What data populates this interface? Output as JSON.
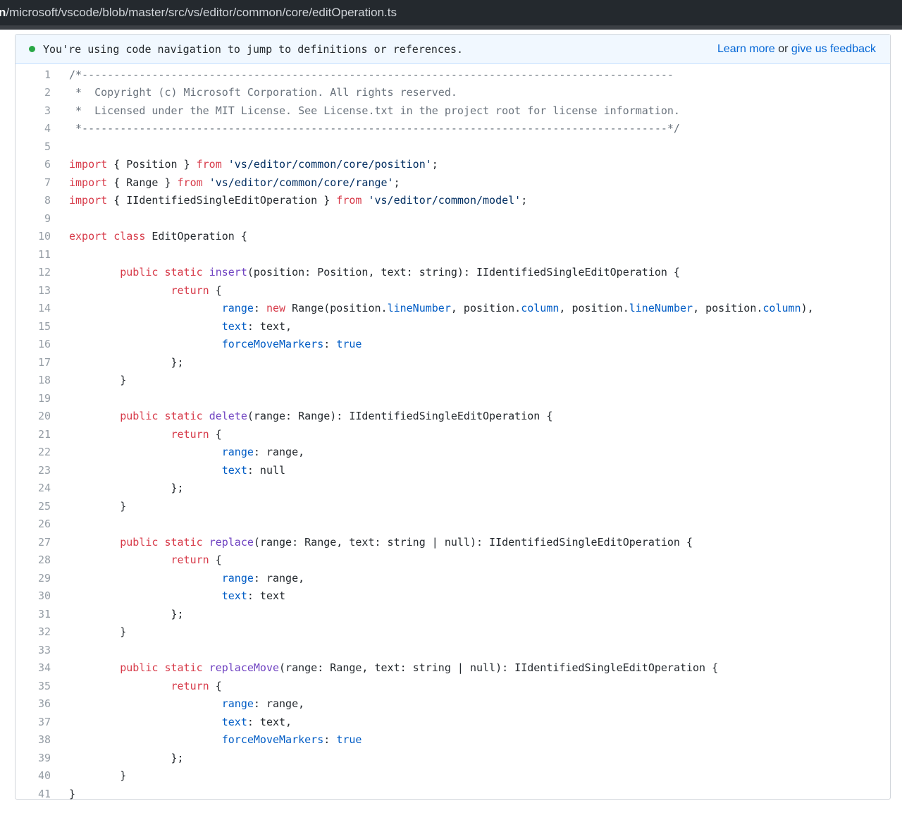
{
  "url_bar": {
    "head": "n",
    "rest": "/microsoft/vscode/blob/master/src/vs/editor/common/core/editOperation.ts"
  },
  "banner": {
    "text": "You're using code navigation to jump to definitions or references.",
    "learn_more": "Learn more",
    "or": "or",
    "feedback": "give us feedback"
  },
  "colors": {
    "keyword": "#d73a49",
    "string": "#032f62",
    "comment": "#6a737d",
    "property": "#005cc5",
    "function": "#6f42c1",
    "link": "#0366d6",
    "status_dot": "#28a745"
  },
  "code_lines": [
    [
      [
        "c",
        "/*---------------------------------------------------------------------------------------------"
      ]
    ],
    [
      [
        "c",
        " *  Copyright (c) Microsoft Corporation. All rights reserved."
      ]
    ],
    [
      [
        "c",
        " *  Licensed under the MIT License. See License.txt in the project root for license information."
      ]
    ],
    [
      [
        "c",
        " *--------------------------------------------------------------------------------------------*/"
      ]
    ],
    [],
    [
      [
        "k",
        "import"
      ],
      [
        "t",
        " { Position } "
      ],
      [
        "k",
        "from"
      ],
      [
        "t",
        " "
      ],
      [
        "s",
        "'vs/editor/common/core/position'"
      ],
      [
        "t",
        ";"
      ]
    ],
    [
      [
        "k",
        "import"
      ],
      [
        "t",
        " { Range } "
      ],
      [
        "k",
        "from"
      ],
      [
        "t",
        " "
      ],
      [
        "s",
        "'vs/editor/common/core/range'"
      ],
      [
        "t",
        ";"
      ]
    ],
    [
      [
        "k",
        "import"
      ],
      [
        "t",
        " { IIdentifiedSingleEditOperation } "
      ],
      [
        "k",
        "from"
      ],
      [
        "t",
        " "
      ],
      [
        "s",
        "'vs/editor/common/model'"
      ],
      [
        "t",
        ";"
      ]
    ],
    [],
    [
      [
        "k",
        "export"
      ],
      [
        "t",
        " "
      ],
      [
        "k",
        "class"
      ],
      [
        "t",
        " EditOperation {"
      ]
    ],
    [],
    [
      [
        "t",
        "\t"
      ],
      [
        "k",
        "public"
      ],
      [
        "t",
        " "
      ],
      [
        "k",
        "static"
      ],
      [
        "t",
        " "
      ],
      [
        "f",
        "insert"
      ],
      [
        "t",
        "(position: Position, text: string): IIdentifiedSingleEditOperation {"
      ]
    ],
    [
      [
        "t",
        "\t\t"
      ],
      [
        "k",
        "return"
      ],
      [
        "t",
        " {"
      ]
    ],
    [
      [
        "t",
        "\t\t\t"
      ],
      [
        "p",
        "range"
      ],
      [
        "t",
        ": "
      ],
      [
        "k",
        "new"
      ],
      [
        "t",
        " Range(position."
      ],
      [
        "p",
        "lineNumber"
      ],
      [
        "t",
        ", position."
      ],
      [
        "p",
        "column"
      ],
      [
        "t",
        ", position."
      ],
      [
        "p",
        "lineNumber"
      ],
      [
        "t",
        ", position."
      ],
      [
        "p",
        "column"
      ],
      [
        "t",
        "),"
      ]
    ],
    [
      [
        "t",
        "\t\t\t"
      ],
      [
        "p",
        "text"
      ],
      [
        "t",
        ": text,"
      ]
    ],
    [
      [
        "t",
        "\t\t\t"
      ],
      [
        "p",
        "forceMoveMarkers"
      ],
      [
        "t",
        ": "
      ],
      [
        "p",
        "true"
      ]
    ],
    [
      [
        "t",
        "\t\t};"
      ]
    ],
    [
      [
        "t",
        "\t}"
      ]
    ],
    [],
    [
      [
        "t",
        "\t"
      ],
      [
        "k",
        "public"
      ],
      [
        "t",
        " "
      ],
      [
        "k",
        "static"
      ],
      [
        "t",
        " "
      ],
      [
        "f",
        "delete"
      ],
      [
        "t",
        "(range: Range): IIdentifiedSingleEditOperation {"
      ]
    ],
    [
      [
        "t",
        "\t\t"
      ],
      [
        "k",
        "return"
      ],
      [
        "t",
        " {"
      ]
    ],
    [
      [
        "t",
        "\t\t\t"
      ],
      [
        "p",
        "range"
      ],
      [
        "t",
        ": range,"
      ]
    ],
    [
      [
        "t",
        "\t\t\t"
      ],
      [
        "p",
        "text"
      ],
      [
        "t",
        ": null"
      ]
    ],
    [
      [
        "t",
        "\t\t};"
      ]
    ],
    [
      [
        "t",
        "\t}"
      ]
    ],
    [],
    [
      [
        "t",
        "\t"
      ],
      [
        "k",
        "public"
      ],
      [
        "t",
        " "
      ],
      [
        "k",
        "static"
      ],
      [
        "t",
        " "
      ],
      [
        "f",
        "replace"
      ],
      [
        "t",
        "(range: Range, text: string | null): IIdentifiedSingleEditOperation {"
      ]
    ],
    [
      [
        "t",
        "\t\t"
      ],
      [
        "k",
        "return"
      ],
      [
        "t",
        " {"
      ]
    ],
    [
      [
        "t",
        "\t\t\t"
      ],
      [
        "p",
        "range"
      ],
      [
        "t",
        ": range,"
      ]
    ],
    [
      [
        "t",
        "\t\t\t"
      ],
      [
        "p",
        "text"
      ],
      [
        "t",
        ": text"
      ]
    ],
    [
      [
        "t",
        "\t\t};"
      ]
    ],
    [
      [
        "t",
        "\t}"
      ]
    ],
    [],
    [
      [
        "t",
        "\t"
      ],
      [
        "k",
        "public"
      ],
      [
        "t",
        " "
      ],
      [
        "k",
        "static"
      ],
      [
        "t",
        " "
      ],
      [
        "f",
        "replaceMove"
      ],
      [
        "t",
        "(range: Range, text: string | null): IIdentifiedSingleEditOperation {"
      ]
    ],
    [
      [
        "t",
        "\t\t"
      ],
      [
        "k",
        "return"
      ],
      [
        "t",
        " {"
      ]
    ],
    [
      [
        "t",
        "\t\t\t"
      ],
      [
        "p",
        "range"
      ],
      [
        "t",
        ": range,"
      ]
    ],
    [
      [
        "t",
        "\t\t\t"
      ],
      [
        "p",
        "text"
      ],
      [
        "t",
        ": text,"
      ]
    ],
    [
      [
        "t",
        "\t\t\t"
      ],
      [
        "p",
        "forceMoveMarkers"
      ],
      [
        "t",
        ": "
      ],
      [
        "p",
        "true"
      ]
    ],
    [
      [
        "t",
        "\t\t};"
      ]
    ],
    [
      [
        "t",
        "\t}"
      ]
    ],
    [
      [
        "t",
        "}"
      ]
    ]
  ]
}
